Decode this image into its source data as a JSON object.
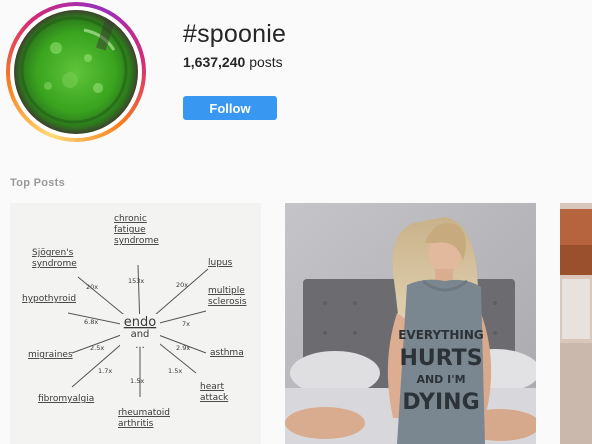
{
  "header": {
    "hashtag": "#spoonie",
    "post_count": "1,637,240",
    "post_count_suffix": "posts",
    "follow_label": "Follow"
  },
  "top_posts": {
    "label": "Top Posts",
    "posts": [
      {
        "kind": "handwritten-diagram",
        "center": [
          "endo",
          "and",
          "..."
        ],
        "conditions": [
          {
            "label": "chronic\nfatigue\nsyndrome",
            "multiplier": "153x"
          },
          {
            "label": "lupus",
            "multiplier": "20x"
          },
          {
            "label": "multiple\nsclerosis",
            "multiplier": "7x"
          },
          {
            "label": "asthma",
            "multiplier": "2.9x"
          },
          {
            "label": "heart\nattack",
            "multiplier": "1.5x"
          },
          {
            "label": "rheumatoid\narthritis",
            "multiplier": "1.5x"
          },
          {
            "label": "fibromyalgia",
            "multiplier": "1.7x"
          },
          {
            "label": "migraines",
            "multiplier": "2.5x"
          },
          {
            "label": "hypothyroid",
            "multiplier": "6.8x"
          },
          {
            "label": "Sjögren's\nsyndrome",
            "multiplier": "20x"
          }
        ]
      },
      {
        "kind": "photo",
        "shirt_text": [
          "EVERYTHING",
          "HURTS",
          "AND I'M",
          "DYING"
        ]
      },
      {
        "kind": "photo-partial"
      }
    ]
  }
}
